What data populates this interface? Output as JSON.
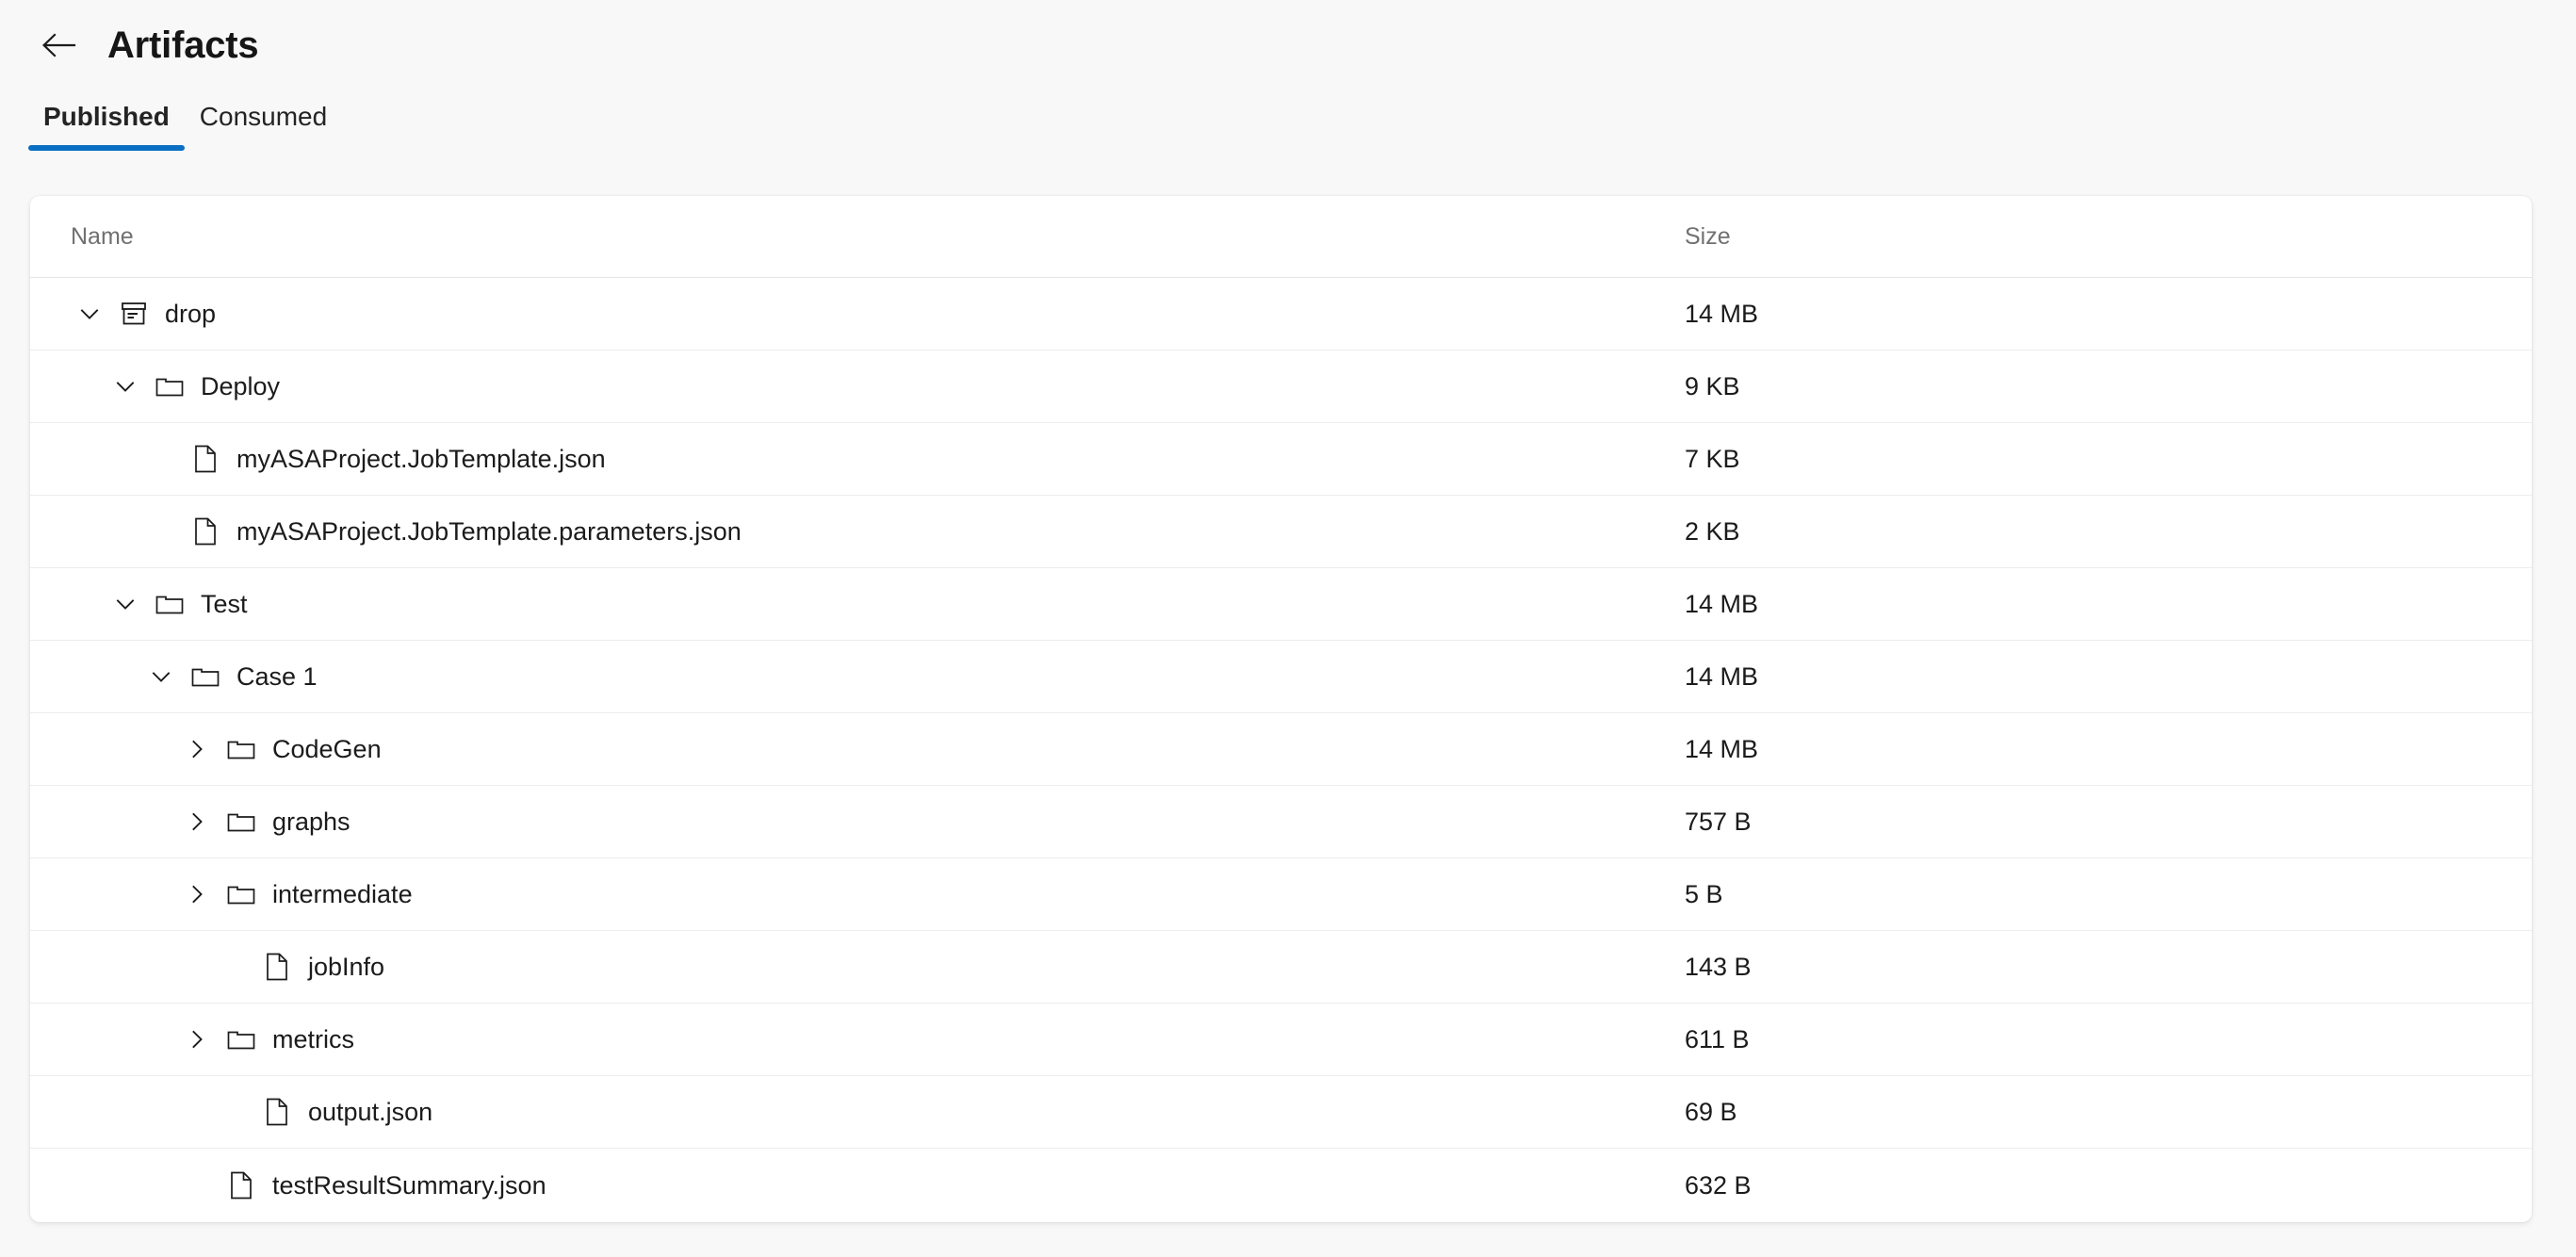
{
  "header": {
    "back_icon": "arrow-left-icon",
    "title": "Artifacts"
  },
  "tabs": [
    {
      "label": "Published",
      "active": true
    },
    {
      "label": "Consumed",
      "active": false
    }
  ],
  "table": {
    "columns": {
      "name": "Name",
      "size": "Size"
    },
    "rows": [
      {
        "name": "drop",
        "size": "14 MB",
        "depth": 0,
        "icon": "archive-icon",
        "twisty": "chevron-down-icon"
      },
      {
        "name": "Deploy",
        "size": "9 KB",
        "depth": 1,
        "icon": "folder-icon",
        "twisty": "chevron-down-icon"
      },
      {
        "name": "myASAProject.JobTemplate.json",
        "size": "7 KB",
        "depth": 2,
        "icon": "file-icon",
        "twisty": "none"
      },
      {
        "name": "myASAProject.JobTemplate.parameters.json",
        "size": "2 KB",
        "depth": 2,
        "icon": "file-icon",
        "twisty": "none"
      },
      {
        "name": "Test",
        "size": "14 MB",
        "depth": 1,
        "icon": "folder-icon",
        "twisty": "chevron-down-icon"
      },
      {
        "name": "Case 1",
        "size": "14 MB",
        "depth": 2,
        "icon": "folder-icon",
        "twisty": "chevron-down-icon"
      },
      {
        "name": "CodeGen",
        "size": "14 MB",
        "depth": 3,
        "icon": "folder-icon",
        "twisty": "chevron-right-icon"
      },
      {
        "name": "graphs",
        "size": "757 B",
        "depth": 3,
        "icon": "folder-icon",
        "twisty": "chevron-right-icon"
      },
      {
        "name": "intermediate",
        "size": "5 B",
        "depth": 3,
        "icon": "folder-icon",
        "twisty": "chevron-right-icon"
      },
      {
        "name": "jobInfo",
        "size": "143 B",
        "depth": 4,
        "icon": "file-icon",
        "twisty": "none"
      },
      {
        "name": "metrics",
        "size": "611 B",
        "depth": 3,
        "icon": "folder-icon",
        "twisty": "chevron-right-icon"
      },
      {
        "name": "output.json",
        "size": "69 B",
        "depth": 4,
        "icon": "file-icon",
        "twisty": "none"
      },
      {
        "name": "testResultSummary.json",
        "size": "632 B",
        "depth": 3,
        "icon": "file-icon",
        "twisty": "none"
      }
    ]
  },
  "colors": {
    "accent": "#0a6fc2",
    "page_background": "#f8f8f8",
    "card_background": "#ffffff",
    "row_divider": "#ededed",
    "text_primary": "#1b1b1b",
    "text_secondary": "#707070"
  }
}
